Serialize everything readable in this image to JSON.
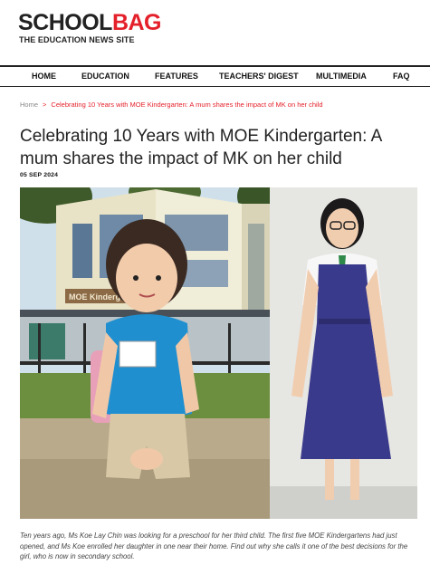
{
  "site": {
    "logo_part1": "SCHOOL",
    "logo_part2": "BAG",
    "tagline": "THE EDUCATION NEWS SITE"
  },
  "nav": {
    "items": [
      "HOME",
      "EDUCATION",
      "FEATURES",
      "TEACHERS' DIGEST",
      "MULTIMEDIA",
      "FAQ"
    ]
  },
  "breadcrumb": {
    "home": "Home",
    "separator": ">",
    "current": "Celebrating 10 Years with MOE Kindergarten: A mum shares the impact of MK on her child"
  },
  "article": {
    "title": "Celebrating 10 Years with MOE Kindergarten: A mum shares the impact of MK on her child",
    "date": "05 SEP 2024",
    "photo_sign_text": "MOE Kindergar",
    "caption": "Ten years ago, Ms Koe Lay Chin was looking for a preschool for her third child. The first five MOE Kindergartens had just opened, and Ms Koe enrolled her daughter in one near their home. Find out why she calls it one of the best decisions for the girl, who is now in secondary school."
  },
  "colors": {
    "brand_red": "#e4202a",
    "text_dark": "#222222"
  }
}
